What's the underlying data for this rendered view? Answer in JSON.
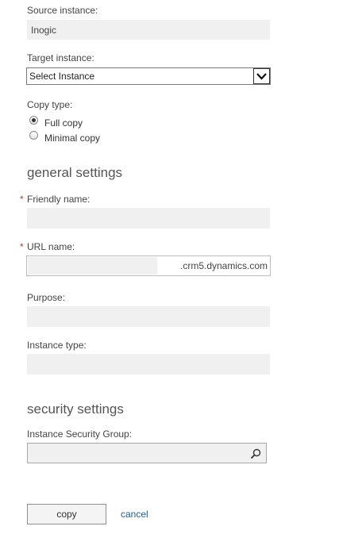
{
  "source_instance": {
    "label": "Source instance:",
    "value": "Inogic"
  },
  "target_instance": {
    "label": "Target instance:",
    "selected": "Select Instance",
    "arrow_icon": "chevron-down-icon"
  },
  "copy_type": {
    "label": "Copy type:",
    "options": [
      {
        "label": "Full copy",
        "checked": true
      },
      {
        "label": "Minimal copy",
        "checked": false
      }
    ]
  },
  "general_settings": {
    "title": "general settings",
    "required_marker": "*",
    "friendly_name": {
      "label": "Friendly name:",
      "value": ""
    },
    "url_name": {
      "label": "URL name:",
      "value": "",
      "suffix": ".crm5.dynamics.com"
    },
    "purpose": {
      "label": "Purpose:",
      "value": ""
    },
    "instance_type": {
      "label": "Instance type:",
      "value": ""
    }
  },
  "security_settings": {
    "title": "security settings",
    "group": {
      "label": "Instance Security Group:",
      "value": "",
      "icon": "search-icon"
    }
  },
  "actions": {
    "copy_label": "copy",
    "cancel_label": "cancel"
  },
  "colors": {
    "required": "#c0392b",
    "link": "#1f5fa8",
    "field_bg": "#f0f0f0"
  }
}
